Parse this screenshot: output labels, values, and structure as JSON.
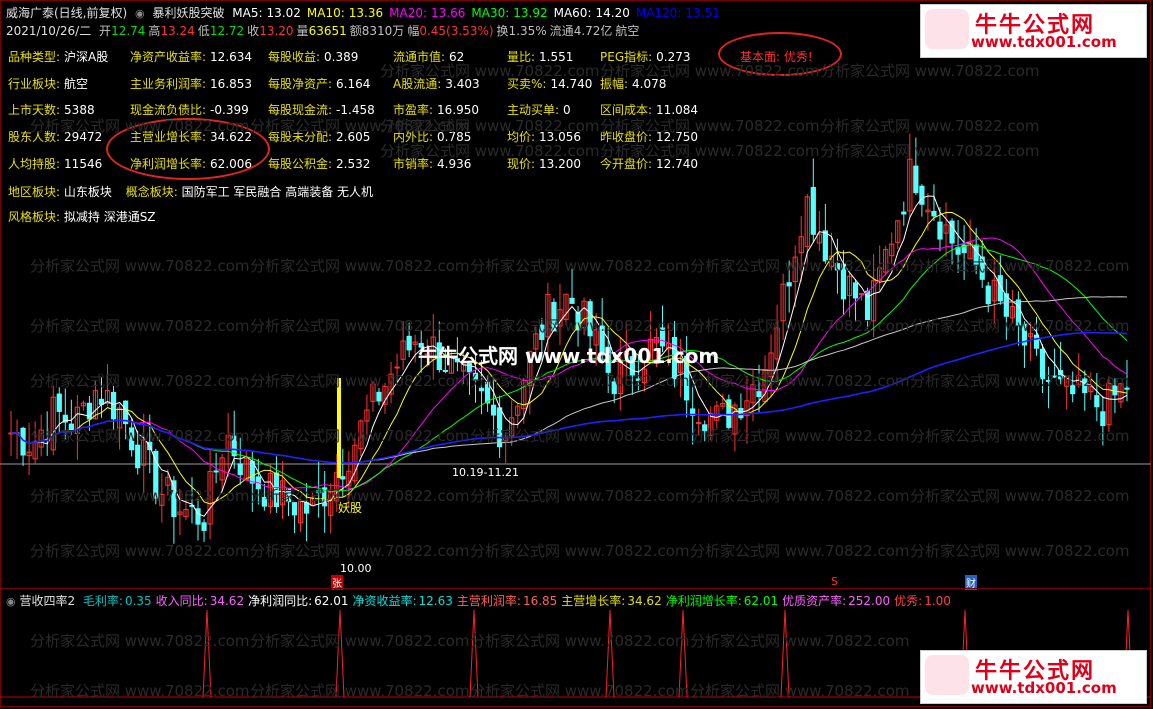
{
  "header": {
    "title": "威海广泰(日线,前复权)",
    "indicator_name": "暴利妖股突破",
    "mas": [
      {
        "label": "MA5:",
        "value": "13.02",
        "color": "#ffffff"
      },
      {
        "label": "MA10:",
        "value": "13.36",
        "color": "#ffff00"
      },
      {
        "label": "MA20:",
        "value": "13.66",
        "color": "#ff00ff"
      },
      {
        "label": "MA30:",
        "value": "13.92",
        "color": "#00ff00"
      },
      {
        "label": "MA60:",
        "value": "14.20",
        "color": "#ffffff"
      },
      {
        "label": "MA120:",
        "value": "13.51",
        "color": "#0000ff"
      }
    ],
    "quote_date": "2021/10/26/二",
    "quote": [
      {
        "label": "开",
        "value": "12.74",
        "color": "#00e000"
      },
      {
        "label": "高",
        "value": "13.24",
        "color": "#ff3030"
      },
      {
        "label": "低",
        "value": "12.72",
        "color": "#00e000"
      },
      {
        "label": "收",
        "value": "13.20",
        "color": "#ff3030"
      },
      {
        "label": "量",
        "value": "63651",
        "color": "#ffff00"
      },
      {
        "label": "额",
        "value": "8310万",
        "color": "#c0c0c0"
      },
      {
        "label": "幅",
        "value": "0.45(3.53%)",
        "color": "#ff3030"
      },
      {
        "label": "换",
        "value": "1.35%",
        "color": "#c0c0c0"
      },
      {
        "label": "流通",
        "value": "4.72亿",
        "color": "#c0c0c0"
      },
      {
        "label": "",
        "value": "航空",
        "color": "#c0c0c0"
      }
    ]
  },
  "info_rows": [
    [
      [
        "品种类型:",
        "沪深A股"
      ],
      [
        "净资产收益率:",
        "12.634"
      ],
      [
        "每股收益:",
        "0.389"
      ],
      [
        "流通市值:",
        "62"
      ],
      [
        "量比:",
        "1.551"
      ],
      [
        "PEG指标:",
        "0.273"
      ]
    ],
    [
      [
        "行业板块:",
        "航空"
      ],
      [
        "主业务利润率:",
        "16.853"
      ],
      [
        "每股净资产:",
        "6.164"
      ],
      [
        "A股流通:",
        "3.403"
      ],
      [
        "买卖%:",
        "14.740"
      ],
      [
        "振幅:",
        "4.078"
      ]
    ],
    [
      [
        "上市天数:",
        "5388"
      ],
      [
        "现金流负债比:",
        "-0.399"
      ],
      [
        "每股现金流:",
        "-1.458"
      ],
      [
        "市盈率:",
        "16.950"
      ],
      [
        "主动买单:",
        "0"
      ],
      [
        "区间成本:",
        "11.084"
      ]
    ],
    [
      [
        "股东人数:",
        "29472"
      ],
      [
        "主营业增长率:",
        "34.622"
      ],
      [
        "每股未分配:",
        "2.605"
      ],
      [
        "内外比:",
        "0.785"
      ],
      [
        "均价:",
        "13.056"
      ],
      [
        "昨收盘价:",
        "12.750"
      ]
    ],
    [
      [
        "人均持股:",
        "11546"
      ],
      [
        "净利润增长率:",
        "62.006"
      ],
      [
        "每股公积金:",
        "2.532"
      ],
      [
        "市销率:",
        "4.936"
      ],
      [
        "现价:",
        "13.200"
      ],
      [
        "今开盘价:",
        "12.740"
      ]
    ]
  ],
  "region": {
    "label": "地区板块:",
    "value": "山东板块",
    "concept_label": "概念板块:",
    "concept_value": "国防军工 军民融合 高端装备 无人机"
  },
  "style": {
    "label": "风格板块:",
    "value": "拟减持 深港通SZ"
  },
  "fundamental": "基本面: 优秀!",
  "center_watermark": "牛牛公式网 www.tdx001.com",
  "watermark_text": "分析家公式网 www.70822.com",
  "logo": {
    "title": "牛牛公式网",
    "url": "www.tdx001.com"
  },
  "annotations": {
    "price_high_date": "10.19-11.21",
    "low_price": "10.00",
    "demon_label": "妖股",
    "marker_zhang": "张",
    "marker_s": "S",
    "marker_cai": "财"
  },
  "indicator": {
    "name": "营收四率2",
    "items": [
      {
        "label": "毛利率:",
        "value": "0.35",
        "color": "#00c0c0"
      },
      {
        "label": "收入同比:",
        "value": "34.62",
        "color": "#ff60ff"
      },
      {
        "label": "净利润同比:",
        "value": "62.01",
        "color": "#ffffff"
      },
      {
        "label": "净资收益率:",
        "value": "12.63",
        "color": "#00e0e0"
      },
      {
        "label": "主营利润率:",
        "value": "16.85",
        "color": "#ff6060"
      },
      {
        "label": "主营增长率:",
        "value": "34.62",
        "color": "#e0e000"
      },
      {
        "label": "净利润增长率:",
        "value": "62.01",
        "color": "#00ff00"
      },
      {
        "label": "优质资产率:",
        "value": "252.00",
        "color": "#ff60ff"
      },
      {
        "label": "优秀:",
        "value": "1.00",
        "color": "#ff4040"
      }
    ]
  },
  "colors": {
    "up": "#ff3232",
    "down": "#54ffff",
    "ma5": "#ffffff",
    "ma10": "#ffff00",
    "ma20": "#ff00ff",
    "ma30": "#00ff00",
    "ma60": "#c8c8c8",
    "ma120": "#2020ff",
    "accent": "#e0261e"
  },
  "chart_data": {
    "type": "candlestick",
    "series_hint": "price path (close) approx",
    "close_path": [
      12.2,
      12.0,
      12.6,
      12.4,
      13.1,
      12.7,
      11.8,
      11.0,
      10.6,
      10.5,
      12.2,
      11.4,
      11.0,
      10.8,
      10.6,
      11.3,
      12.0,
      12.9,
      13.6,
      14.2,
      13.8,
      13.2,
      12.8,
      12.2,
      13.5,
      14.6,
      15.0,
      14.2,
      13.3,
      13.6,
      14.0,
      13.5,
      12.8,
      12.4,
      12.9,
      13.4,
      15.0,
      17.0,
      16.0,
      15.2,
      14.6,
      16.2,
      17.6,
      16.8,
      16.0,
      15.6,
      14.8,
      14.2,
      13.4,
      13.0,
      12.9,
      12.7,
      13.2
    ]
  }
}
